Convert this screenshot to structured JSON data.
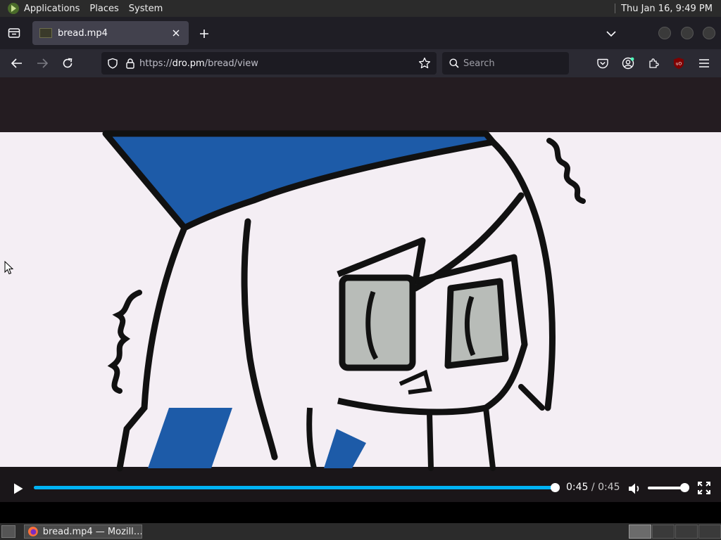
{
  "top_panel": {
    "menus": [
      "Applications",
      "Places",
      "System"
    ],
    "clock": "Thu Jan 16,  9:49 PM"
  },
  "tab": {
    "title": "bread.mp4"
  },
  "urlbar": {
    "scheme": "https://",
    "host": "dro.pm",
    "path": "/bread/view"
  },
  "search": {
    "placeholder": "Search"
  },
  "video": {
    "progress_fraction": 1.0,
    "current_time": "0:45",
    "separator": " / ",
    "duration": "0:45",
    "volume_fraction": 1.0,
    "accent_color": "#00b3f4"
  },
  "taskbar": {
    "task_label": "bread.mp4 — Mozill…"
  },
  "colors": {
    "panel": "#2b2b2b",
    "tabbar": "#1f1e25",
    "navbar": "#2b2a33",
    "urlbar": "#1c1b22",
    "drawing_blue": "#1d5ba8"
  }
}
